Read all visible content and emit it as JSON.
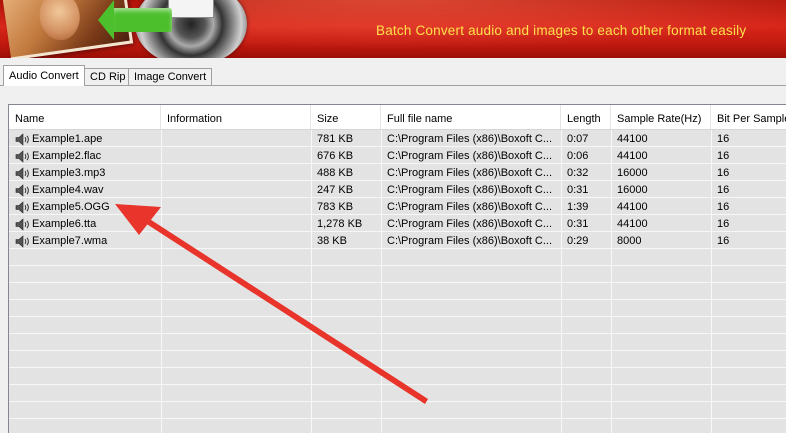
{
  "banner": {
    "tagline": "Batch Convert  audio and images to each other format easily"
  },
  "tabs": [
    {
      "label": "Audio Convert",
      "active": true
    },
    {
      "label": "CD Rip",
      "active": false
    },
    {
      "label": "Image Convert",
      "active": false
    }
  ],
  "list": {
    "columns": [
      "Name",
      "Information",
      "Size",
      "Full file name",
      "Length",
      "Sample Rate(Hz)",
      "Bit Per Sample(Bit)"
    ],
    "rows": [
      {
        "name": "Example1.ape",
        "information": "",
        "size": "781 KB",
        "full": "C:\\Program Files (x86)\\Boxoft C...",
        "length": "0:07",
        "rate": "44100",
        "bits": "16"
      },
      {
        "name": "Example2.flac",
        "information": "",
        "size": "676 KB",
        "full": "C:\\Program Files (x86)\\Boxoft C...",
        "length": "0:06",
        "rate": "44100",
        "bits": "16"
      },
      {
        "name": "Example3.mp3",
        "information": "",
        "size": "488 KB",
        "full": "C:\\Program Files (x86)\\Boxoft C...",
        "length": "0:32",
        "rate": "16000",
        "bits": "16"
      },
      {
        "name": "Example4.wav",
        "information": "",
        "size": "247 KB",
        "full": "C:\\Program Files (x86)\\Boxoft C...",
        "length": "0:31",
        "rate": "16000",
        "bits": "16"
      },
      {
        "name": "Example5.OGG",
        "information": "",
        "size": "783 KB",
        "full": "C:\\Program Files (x86)\\Boxoft C...",
        "length": "1:39",
        "rate": "44100",
        "bits": "16"
      },
      {
        "name": "Example6.tta",
        "information": "",
        "size": "1,278 KB",
        "full": "C:\\Program Files (x86)\\Boxoft C...",
        "length": "0:31",
        "rate": "44100",
        "bits": "16"
      },
      {
        "name": "Example7.wma",
        "information": "",
        "size": "38 KB",
        "full": "C:\\Program Files (x86)\\Boxoft C...",
        "length": "0:29",
        "rate": "8000",
        "bits": "16"
      }
    ]
  },
  "icons": {
    "row_icon": "speaker-icon"
  },
  "colors": {
    "banner_red": "#c21a10",
    "tagline_yellow": "#ffe04a",
    "annotation_red": "#e8342a",
    "list_bg": "#e3e3e3"
  }
}
